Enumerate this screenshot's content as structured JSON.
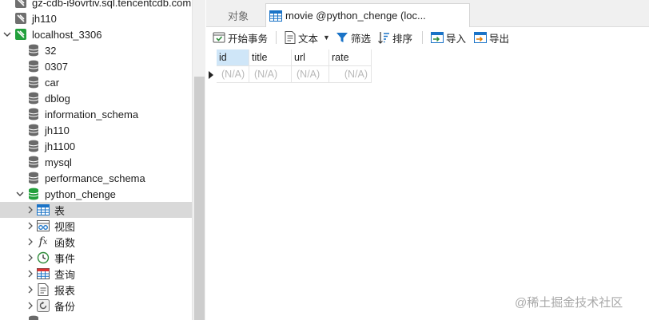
{
  "tree": {
    "items": [
      {
        "label": "gz-cdb-i9ovrtiv.sql.tencentcdb.com",
        "icon": "server-disconnected-icon"
      },
      {
        "label": "jh110",
        "icon": "server-disconnected-icon"
      },
      {
        "label": "localhost_3306",
        "icon": "server-connected-icon"
      },
      {
        "label": "32",
        "icon": "database-icon"
      },
      {
        "label": "0307",
        "icon": "database-icon"
      },
      {
        "label": "car",
        "icon": "database-icon"
      },
      {
        "label": "dblog",
        "icon": "database-icon"
      },
      {
        "label": "information_schema",
        "icon": "database-icon"
      },
      {
        "label": "jh110",
        "icon": "database-icon"
      },
      {
        "label": "jh1100",
        "icon": "database-icon"
      },
      {
        "label": "mysql",
        "icon": "database-icon"
      },
      {
        "label": "performance_schema",
        "icon": "database-icon"
      },
      {
        "label": "python_chenge",
        "icon": "database-open-icon"
      },
      {
        "label": "表",
        "icon": "table-icon"
      },
      {
        "label": "视图",
        "icon": "view-icon"
      },
      {
        "label": "函数",
        "icon": "function-icon"
      },
      {
        "label": "事件",
        "icon": "event-clock-icon"
      },
      {
        "label": "查询",
        "icon": "query-icon"
      },
      {
        "label": "报表",
        "icon": "report-icon"
      },
      {
        "label": "备份",
        "icon": "backup-icon"
      },
      {
        "label": "",
        "icon": "database-icon"
      }
    ]
  },
  "tabs": {
    "objects_label": "对象",
    "active_label": "movie @python_chenge (loc..."
  },
  "toolbar": {
    "begin_transaction": "开始事务",
    "text": "文本",
    "filter": "筛选",
    "sort": "排序",
    "import": "导入",
    "export": "导出"
  },
  "grid": {
    "columns": [
      "id",
      "title",
      "url",
      "rate"
    ],
    "rows": [
      [
        "(N/A)",
        "(N/A)",
        "(N/A)",
        "(N/A)"
      ]
    ]
  },
  "watermark": "@稀土掘金技术社区",
  "colors": {
    "accent": "#1a73c7",
    "db_open": "#22a03c",
    "selected_row": "#d9d9d9",
    "header_selected": "#cfe6f8"
  }
}
